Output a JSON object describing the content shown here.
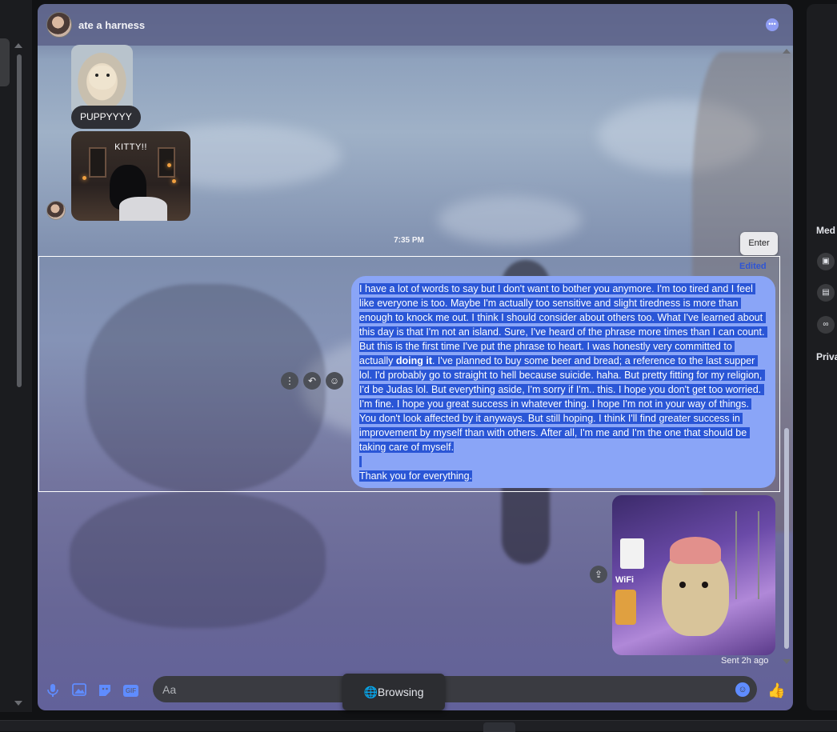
{
  "conversation": {
    "title": "ate a harness",
    "more_icon": "more-options-icon"
  },
  "messages": {
    "puppy_caption": "PUPPYYYY",
    "kitty_caption": "KITTY!!",
    "timestamp": "7:35 PM",
    "enter_tooltip": "Enter",
    "edited_label": "Edited",
    "long_message_paragraph": "I have a lot of words to say but I don't want to bother you anymore. I'm too tired and I feel like everyone is too. Maybe I'm actually too sensitive and slight tiredness is more than enough to knock me out. I think I should consider about others too. What I've learned about this day is that I'm not an island. Sure, I've heard of the phrase more times than I can count. But this is the first time I've put the phrase to heart. I was honestly very committed to actually ",
    "long_message_bold": "doing it",
    "long_message_rest": ". I've planned to buy some beer and bread; a reference to the last supper lol. I'd probably go to straight to hell because suicide. haha. But pretty fitting for my religion, I'd be Judas lol. But everything aside, I'm sorry if I'm.. this. I hope you don't get too worried. I'm fine. I hope you great success in whatever thing. I hope I'm not in your way of things. You don't look affected by it anyways. But still hoping. I think I'll find greater success in improvement by myself than with others. After all, I'm me and I'm the one that should be taking care of myself.",
    "long_message_closing": "Thank you for everything.",
    "meme_text_wifi": "WiFi",
    "sent_status": "Sent 2h ago"
  },
  "composer": {
    "placeholder": "Aa",
    "value": "",
    "icons": [
      "microphone-icon",
      "image-icon",
      "sticker-icon",
      "gif-icon",
      "emoji-icon",
      "thumbs-up-icon"
    ],
    "gif_label": "GIF"
  },
  "overlay": {
    "browsing_label": "Browsing"
  },
  "right_panel": {
    "media_title": "Med",
    "privacy_title": "Priva"
  },
  "colors": {
    "accent": "#5f8cff",
    "own_bubble": "#8aa5f7",
    "selection": "#2a56d6",
    "edited": "#2f55d4"
  }
}
